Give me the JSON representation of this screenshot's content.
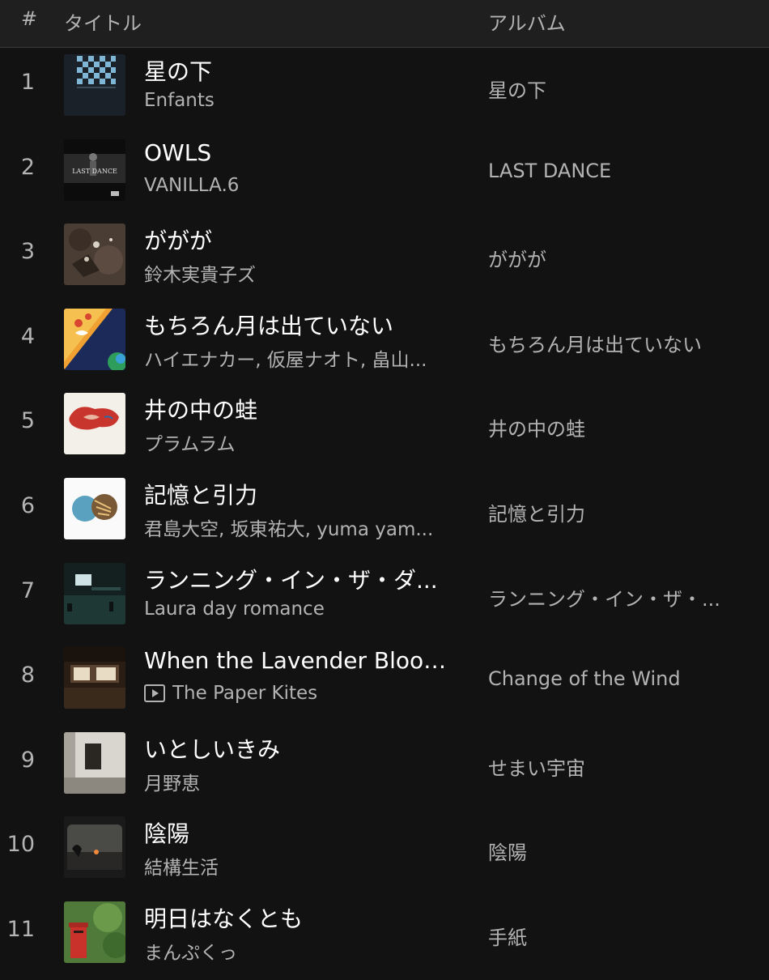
{
  "header": {
    "num": "#",
    "title": "タイトル",
    "album": "アルバム"
  },
  "tracks": [
    {
      "num": "1",
      "title": "星の下",
      "artist": "Enfants",
      "album": "星の下",
      "art_icon": "checkered-cover",
      "video": false
    },
    {
      "num": "2",
      "title": "OWLS",
      "artist": "VANILLA.6",
      "album": "LAST DANCE",
      "art_icon": "last-dance-cover",
      "art_text": "LAST DANCE",
      "video": false
    },
    {
      "num": "3",
      "title": "ががが",
      "artist": "鈴木実貴子ズ",
      "album": "ががが",
      "art_icon": "rubble-cover",
      "video": false
    },
    {
      "num": "4",
      "title": "もちろん月は出ていない",
      "artist": "ハイエナカー, 仮屋ナオト, 畠山...",
      "album": "もちろん月は出ていない",
      "art_icon": "pizza-cover",
      "video": false
    },
    {
      "num": "5",
      "title": "井の中の蛙",
      "artist": "プラムラム",
      "album": "井の中の蛙",
      "art_icon": "red-blot-cover",
      "video": false
    },
    {
      "num": "6",
      "title": "記憶と引力",
      "artist": "君島大空, 坂東祐大, yuma yam...",
      "album": "記憶と引力",
      "art_icon": "circles-cover",
      "video": false
    },
    {
      "num": "7",
      "title": "ランニング・イン・ザ・ダ...",
      "artist": "Laura day romance",
      "album": "ランニング・イン・ザ・...",
      "art_icon": "pool-cover",
      "video": false
    },
    {
      "num": "8",
      "title": "When the Lavender Blooms",
      "artist": "The Paper Kites",
      "album": "Change of the Wind",
      "art_icon": "sign-cover",
      "video": true
    },
    {
      "num": "9",
      "title": "いとしいきみ",
      "artist": "月野恵",
      "album": "せまい宇宙",
      "art_icon": "room-cover",
      "video": false
    },
    {
      "num": "10",
      "title": "陰陽",
      "artist": "結構生活",
      "album": "陰陽",
      "art_icon": "sunset-cover",
      "video": false
    },
    {
      "num": "11",
      "title": "明日はなくとも",
      "artist": "まんぷくっ",
      "album": "手紙",
      "art_icon": "postbox-cover",
      "video": false
    }
  ]
}
